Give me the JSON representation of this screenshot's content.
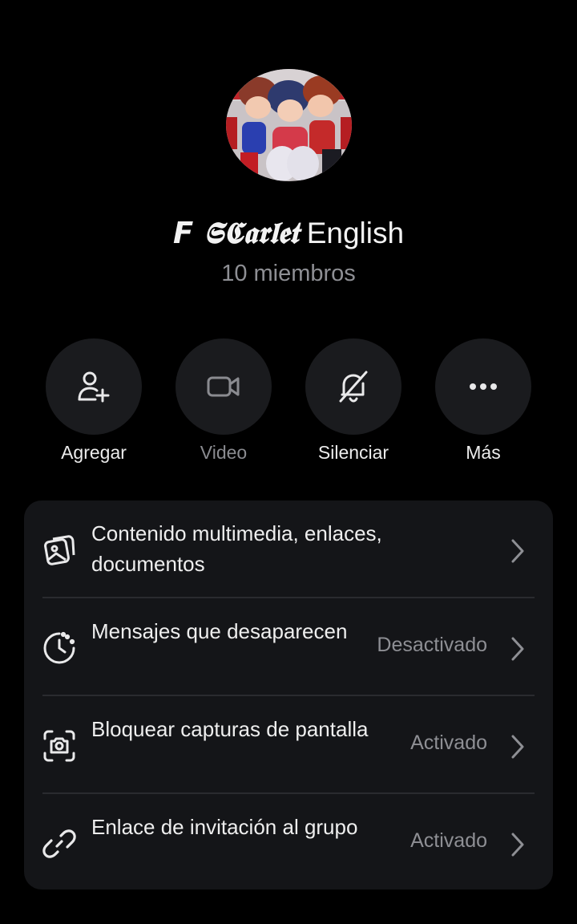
{
  "group": {
    "name_styled": "𝙁 𝕾𝕮𝖆𝖗𝖑𝖊𝖙",
    "name_plain": "English",
    "members": "10 miembros"
  },
  "actions": [
    {
      "label": "Agregar",
      "icon": "add-user-icon",
      "enabled": true
    },
    {
      "label": "Video",
      "icon": "video-camera-icon",
      "enabled": false
    },
    {
      "label": "Silenciar",
      "icon": "bell-off-icon",
      "enabled": true
    },
    {
      "label": "Más",
      "icon": "more-dots-icon",
      "enabled": true
    }
  ],
  "settings": [
    {
      "label": "Contenido multimedia, enlaces, documentos",
      "value": "",
      "icon": "media-gallery-icon"
    },
    {
      "label": "Mensajes que desaparecen",
      "value": "Desactivado",
      "icon": "timer-icon"
    },
    {
      "label": "Bloquear capturas de pantalla",
      "value": "Activado",
      "icon": "screenshot-camera-icon"
    },
    {
      "label": "Enlace de invitación al grupo",
      "value": "Activado",
      "icon": "link-icon"
    }
  ],
  "colors": {
    "background": "#000000",
    "card": "#141518",
    "button": "#1a1b1e",
    "secondary_text": "#8e8f94"
  }
}
